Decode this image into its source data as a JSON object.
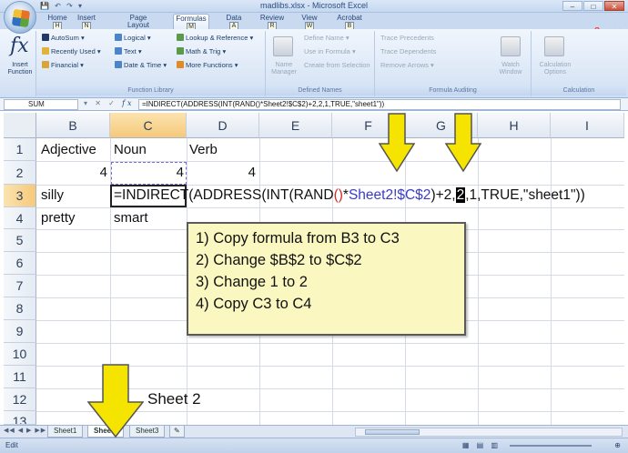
{
  "window": {
    "title": "madlibs.xlsx - Microsoft Excel",
    "controls": [
      "–",
      "□",
      "✕"
    ]
  },
  "ribbon": {
    "tabs": [
      {
        "label": "Home",
        "key": "H"
      },
      {
        "label": "Insert",
        "key": "N"
      },
      {
        "label": "Page Layout",
        "key": "P"
      },
      {
        "label": "Formulas",
        "key": "M"
      },
      {
        "label": "Data",
        "key": "A"
      },
      {
        "label": "Review",
        "key": "R"
      },
      {
        "label": "View",
        "key": "W"
      },
      {
        "label": "Acrobat",
        "key": "B"
      }
    ],
    "active_tab": "Formulas",
    "insert_function": "Insert Function",
    "function_library": {
      "items": [
        "AutoSum",
        "Recently Used",
        "Financial",
        "Logical",
        "Text",
        "Date & Time",
        "Lookup & Reference",
        "Math & Trig",
        "More Functions"
      ],
      "label": "Function Library"
    },
    "defined_names": {
      "name_manager": "Name Manager",
      "items": [
        "Define Name",
        "Use in Formula",
        "Create from Selection"
      ],
      "label": "Defined Names"
    },
    "formula_auditing": {
      "items": [
        "Trace Precedents",
        "Trace Dependents",
        "Remove Arrows"
      ],
      "watch": "Watch Window",
      "label": "Formula Auditing"
    },
    "calculation": {
      "options": "Calculation Options",
      "label": "Calculation"
    }
  },
  "formula_bar": {
    "name_box": "SUM",
    "formula": "=INDIRECT(ADDRESS(INT(RAND()*Sheet2!$C$2)+2,2,1,TRUE,\"sheet1\"))"
  },
  "grid": {
    "columns": [
      "B",
      "C",
      "D",
      "E",
      "F",
      "G",
      "H",
      "I"
    ],
    "rows": [
      "1",
      "2",
      "3",
      "4",
      "5",
      "6",
      "7",
      "8",
      "9",
      "10",
      "11",
      "12",
      "13"
    ],
    "cells": {
      "B1": "Adjective",
      "C1": "Noun",
      "D1": "Verb",
      "B2": "4",
      "C2": "4",
      "D2": "4",
      "B3": "silly",
      "B4": "pretty",
      "C4": "smart"
    },
    "editing_formula": {
      "part1": "=INDIRECT(ADDRESS(INT(RAND",
      "paren": "()",
      "part2": "*",
      "ref": "Sheet2!$C$2",
      "part3": ")+2,",
      "highlight": "2",
      "part4": ",1,TRUE,\"sheet1\"))"
    }
  },
  "callout": {
    "steps": [
      "1) Copy  formula from B3 to C3",
      "2) Change $B$2 to $C$2",
      "3) Change 1 to 2",
      "4) Copy C3 to C4"
    ]
  },
  "annotation": {
    "sheet_label": "Sheet 2"
  },
  "sheet_tabs": [
    "Sheet1",
    "Sheet2",
    "Sheet3"
  ],
  "active_sheet": "Sheet2",
  "status": {
    "mode": "Edit"
  },
  "colors": {
    "arrow": "#f5e400",
    "callout_bg": "#fbf7c0",
    "ref_blue": "#3b3bc8",
    "paren_red": "#d12a2a"
  }
}
